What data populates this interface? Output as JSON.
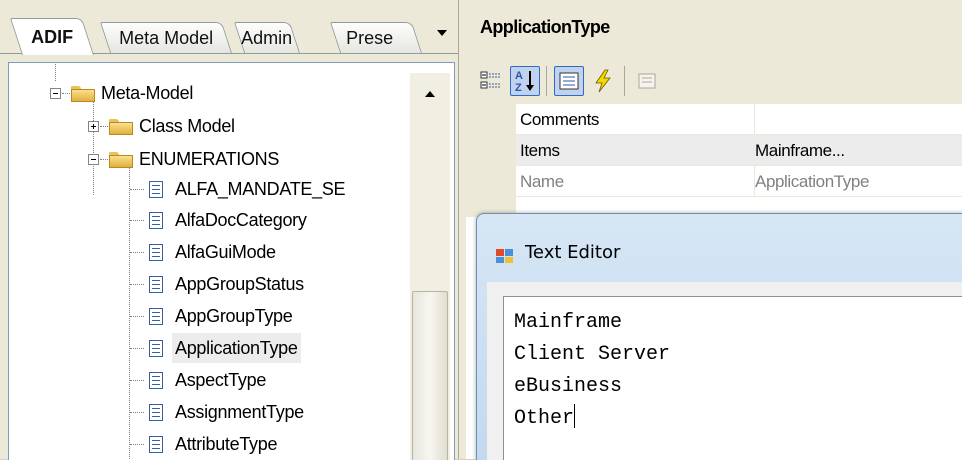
{
  "left_panel": {
    "tabs": [
      "ADIF",
      "Meta Model",
      "Admin",
      "Prese"
    ],
    "active_tab": "ADIF",
    "tree": {
      "root": "Meta-Model",
      "class_model": "Class Model",
      "enumerations": "ENUMERATIONS",
      "items": [
        "ALFA_MANDATE_SE",
        "AlfaDocCategory",
        "AlfaGuiMode",
        "AppGroupStatus",
        "AppGroupType",
        "ApplicationType",
        "AspectType",
        "AssignmentType",
        "AttributeType"
      ],
      "selected": "ApplicationType"
    }
  },
  "property_grid": {
    "title": "ApplicationType",
    "rows": [
      {
        "name": "Comments",
        "value": ""
      },
      {
        "name": "Items",
        "value": "Mainframe..."
      },
      {
        "name": "Name",
        "value": "ApplicationType"
      }
    ]
  },
  "text_editor": {
    "title": "Text Editor",
    "lines": [
      "Mainframe",
      "Client Server",
      "eBusiness",
      "Other"
    ]
  }
}
